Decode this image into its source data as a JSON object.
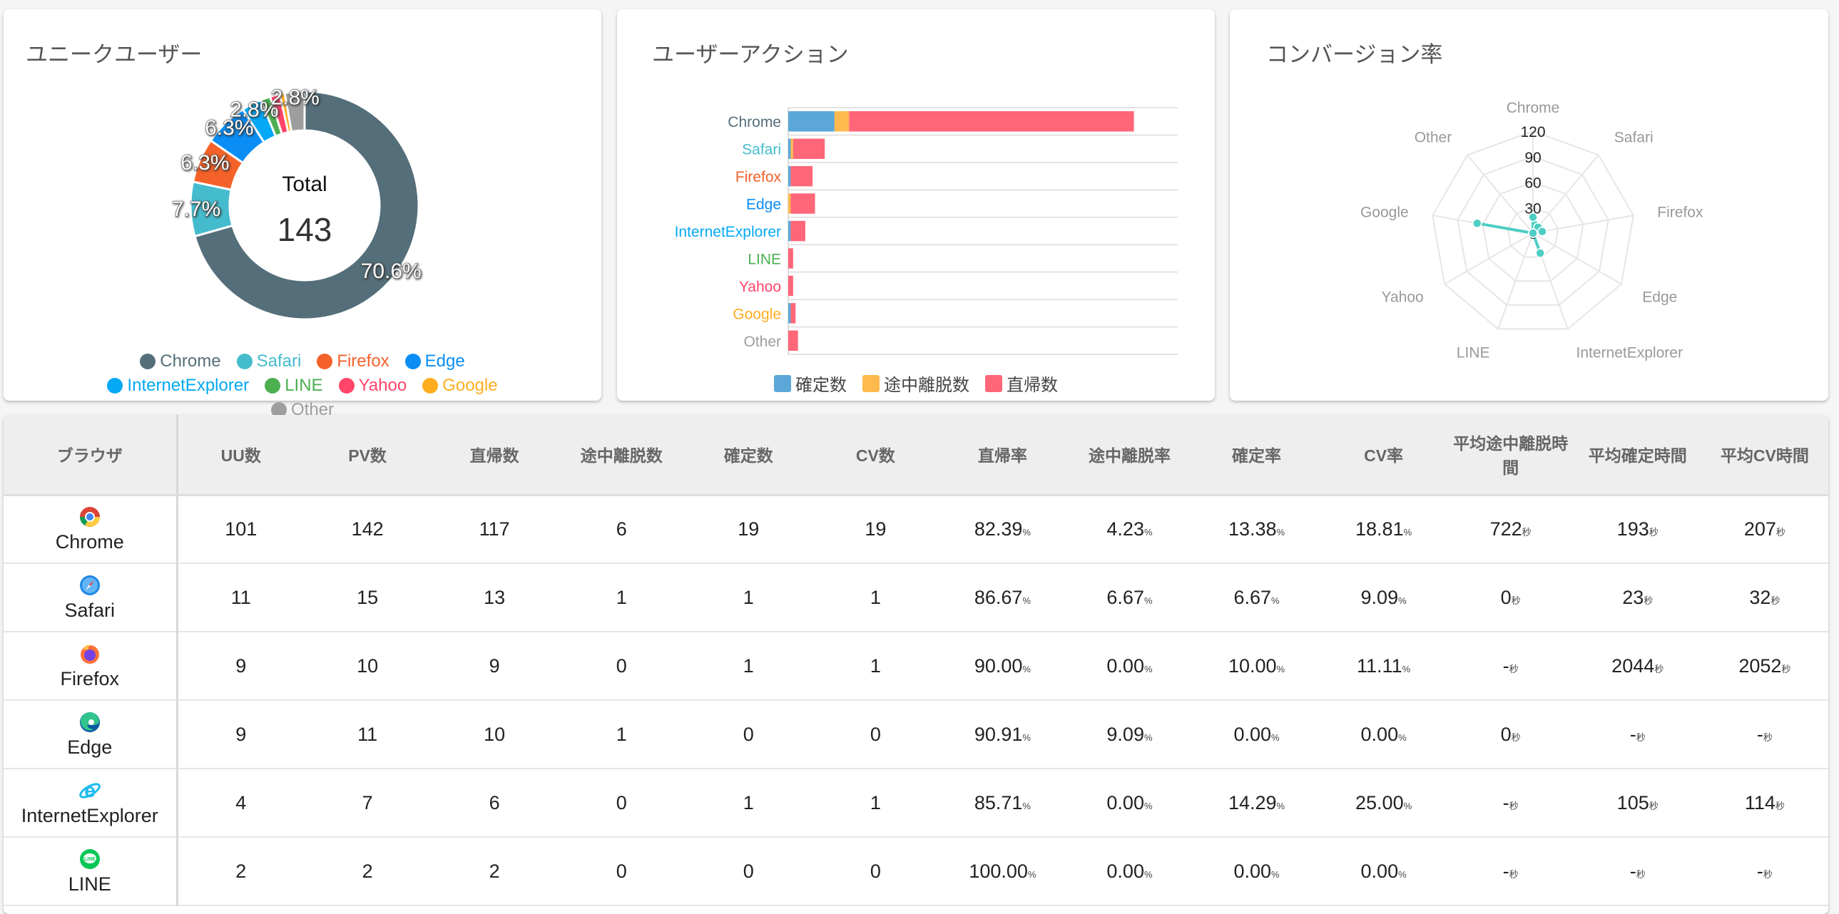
{
  "cards": {
    "unique_users": {
      "title": "ユニークユーザー",
      "center_label": "Total",
      "center_value": "143"
    },
    "user_actions": {
      "title": "ユーザーアクション"
    },
    "conversion": {
      "title": "コンバージョン率"
    }
  },
  "colors": {
    "Chrome": "#546e7a",
    "Safari": "#45bccd",
    "Firefox": "#f4622a",
    "Edge": "#0a8ef5",
    "InternetExplorer": "#03a9f4",
    "LINE": "#4caf50",
    "Yahoo": "#ff4569",
    "Google": "#ffad1f",
    "Other": "#9e9e9e",
    "confirm": "#5ba8d8",
    "abandon": "#ffb94d",
    "bounce": "#ff6678",
    "radar": "#4ecdc4"
  },
  "chart_data": [
    {
      "type": "pie",
      "variant": "doughnut",
      "title": "ユニークユーザー",
      "categories": [
        "Chrome",
        "Safari",
        "Firefox",
        "Edge",
        "InternetExplorer",
        "LINE",
        "Yahoo",
        "Google",
        "Other"
      ],
      "values": [
        101,
        11,
        9,
        9,
        4,
        2,
        2,
        1,
        4
      ],
      "data_labels": [
        "70.6%",
        "7.7%",
        "6.3%",
        "6.3%",
        "2.8%",
        "",
        "",
        "",
        "2.8%"
      ],
      "legend": "bottom"
    },
    {
      "type": "bar",
      "orientation": "horizontal",
      "stacked": true,
      "title": "ユーザーアクション",
      "categories": [
        "Chrome",
        "Safari",
        "Firefox",
        "Edge",
        "InternetExplorer",
        "LINE",
        "Yahoo",
        "Google",
        "Other"
      ],
      "series": [
        {
          "name": "確定数",
          "values": [
            19,
            1,
            1,
            0,
            1,
            0,
            0,
            1,
            0
          ]
        },
        {
          "name": "途中離脱数",
          "values": [
            6,
            1,
            0,
            1,
            0,
            0,
            0,
            0,
            0
          ]
        },
        {
          "name": "直帰数",
          "values": [
            117,
            13,
            9,
            10,
            6,
            2,
            2,
            2,
            4
          ]
        }
      ],
      "xlim": [
        0,
        160
      ],
      "grid": true,
      "legend": "bottom"
    },
    {
      "type": "radar",
      "title": "コンバージョン率",
      "categories": [
        "Chrome",
        "Safari",
        "Firefox",
        "Edge",
        "InternetExplorer",
        "LINE",
        "Yahoo",
        "Google",
        "Other"
      ],
      "values": [
        18.81,
        9.09,
        11.11,
        0,
        25,
        0,
        0,
        66.67,
        0
      ],
      "ticks": [
        "0",
        "30",
        "60",
        "90",
        "120"
      ],
      "rlim": [
        0,
        120
      ]
    }
  ],
  "table": {
    "headers": [
      "ブラウザ",
      "UU数",
      "PV数",
      "直帰数",
      "途中離脱数",
      "確定数",
      "CV数",
      "直帰率",
      "途中離脱率",
      "確定率",
      "CV率",
      "平均途中離脱時間",
      "平均確定時間",
      "平均CV時間"
    ],
    "pct_unit": "%",
    "sec_unit": "秒",
    "rows": [
      {
        "browser": "Chrome",
        "icon": "chrome-icon",
        "counts": [
          "101",
          "142",
          "117",
          "6",
          "19",
          "19"
        ],
        "rates": [
          "82.39",
          "4.23",
          "13.38",
          "18.81"
        ],
        "times": [
          "722",
          "193",
          "207"
        ]
      },
      {
        "browser": "Safari",
        "icon": "safari-icon",
        "counts": [
          "11",
          "15",
          "13",
          "1",
          "1",
          "1"
        ],
        "rates": [
          "86.67",
          "6.67",
          "6.67",
          "9.09"
        ],
        "times": [
          "0",
          "23",
          "32"
        ]
      },
      {
        "browser": "Firefox",
        "icon": "firefox-icon",
        "counts": [
          "9",
          "10",
          "9",
          "0",
          "1",
          "1"
        ],
        "rates": [
          "90.00",
          "0.00",
          "10.00",
          "11.11"
        ],
        "times": [
          "-",
          "2044",
          "2052"
        ]
      },
      {
        "browser": "Edge",
        "icon": "edge-icon",
        "counts": [
          "9",
          "11",
          "10",
          "1",
          "0",
          "0"
        ],
        "rates": [
          "90.91",
          "9.09",
          "0.00",
          "0.00"
        ],
        "times": [
          "0",
          "-",
          "-"
        ]
      },
      {
        "browser": "InternetExplorer",
        "icon": "internet-explorer-icon",
        "counts": [
          "4",
          "7",
          "6",
          "0",
          "1",
          "1"
        ],
        "rates": [
          "85.71",
          "0.00",
          "14.29",
          "25.00"
        ],
        "times": [
          "-",
          "105",
          "114"
        ]
      },
      {
        "browser": "LINE",
        "icon": "line-icon",
        "counts": [
          "2",
          "2",
          "2",
          "0",
          "0",
          "0"
        ],
        "rates": [
          "100.00",
          "0.00",
          "0.00",
          "0.00"
        ],
        "times": [
          "-",
          "-",
          "-"
        ]
      }
    ]
  }
}
